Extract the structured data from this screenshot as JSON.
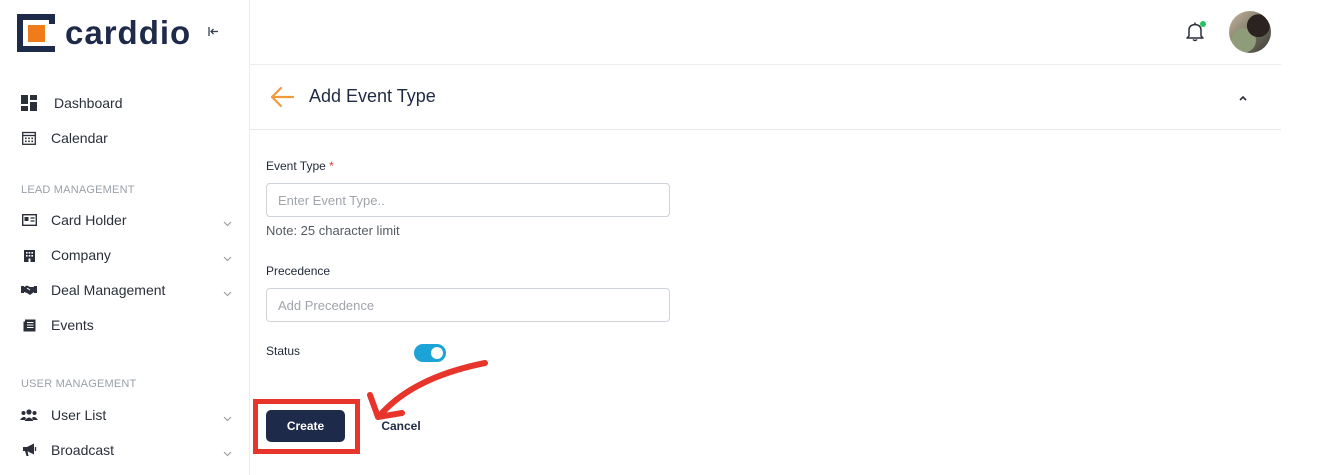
{
  "brand": {
    "name": "carddio",
    "accent": "#ef7b1a",
    "primary": "#1e2a4a"
  },
  "sidebar": {
    "top_items": [
      {
        "label": "Dashboard",
        "icon": "dashboard-icon"
      },
      {
        "label": "Calendar",
        "icon": "calendar-icon"
      }
    ],
    "sections": [
      {
        "title": "LEAD MANAGEMENT",
        "items": [
          {
            "label": "Card Holder",
            "icon": "id-card-icon",
            "expandable": true
          },
          {
            "label": "Company",
            "icon": "building-icon",
            "expandable": true
          },
          {
            "label": "Deal Management",
            "icon": "handshake-icon",
            "expandable": true
          },
          {
            "label": "Events",
            "icon": "events-icon",
            "expandable": false
          }
        ]
      },
      {
        "title": "USER MANAGEMENT",
        "items": [
          {
            "label": "User List",
            "icon": "users-icon",
            "expandable": true
          },
          {
            "label": "Broadcast",
            "icon": "megaphone-icon",
            "expandable": true
          }
        ]
      }
    ]
  },
  "topbar": {
    "notification_icon": "bell-icon",
    "has_notification": true
  },
  "page": {
    "title": "Add Event Type",
    "form": {
      "event_type": {
        "label": "Event Type",
        "required_mark": "*",
        "value": "",
        "placeholder": "Enter Event Type..",
        "note": "Note: 25 character limit"
      },
      "precedence": {
        "label": "Precedence",
        "value": "",
        "placeholder": "Add Precedence"
      },
      "status": {
        "label": "Status",
        "enabled": true
      },
      "create_label": "Create",
      "cancel_label": "Cancel"
    }
  },
  "annotation": {
    "color": "#e8352b",
    "target": "create-button"
  }
}
